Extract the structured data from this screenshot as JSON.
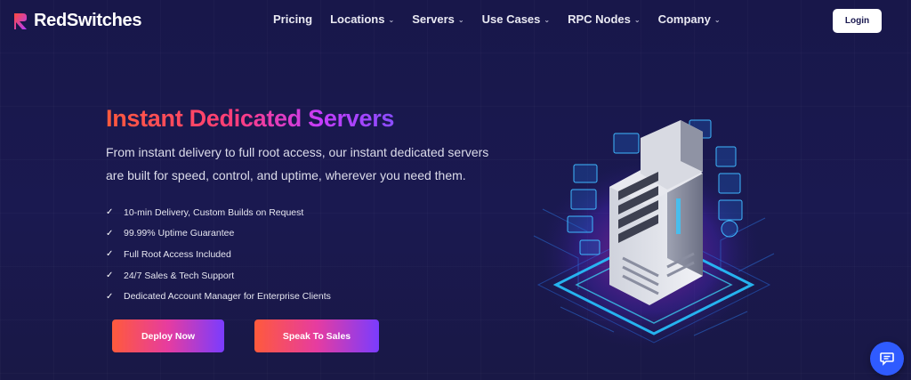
{
  "brand": {
    "name": "RedSwitches"
  },
  "nav": {
    "items": [
      {
        "label": "Pricing",
        "dropdown": false
      },
      {
        "label": "Locations",
        "dropdown": true
      },
      {
        "label": "Servers",
        "dropdown": true
      },
      {
        "label": "Use Cases",
        "dropdown": true
      },
      {
        "label": "RPC Nodes",
        "dropdown": true
      },
      {
        "label": "Company",
        "dropdown": true
      }
    ],
    "login_label": "Login"
  },
  "hero": {
    "title": "Instant Dedicated Servers",
    "description": "From instant delivery to full root access, our instant dedicated servers are built for speed, control, and uptime, wherever you need them.",
    "features": [
      "10-min Delivery, Custom Builds on Request",
      "99.99% Uptime Guarantee",
      "Full Root Access Included",
      "24/7 Sales & Tech Support",
      "Dedicated Account Manager for Enterprise Clients"
    ],
    "primary_button": "Deploy Now",
    "secondary_button": "Speak To Sales"
  },
  "icons": {
    "chevron": "chevron-down-icon",
    "check": "check-icon",
    "chat": "chat-icon"
  },
  "colors": {
    "background": "#19184d",
    "gradient_start": "#ff5a3c",
    "gradient_mid": "#e63ca0",
    "gradient_end": "#7a3cff",
    "chat_button": "#2f5bff",
    "login_bg": "#ffffff"
  }
}
